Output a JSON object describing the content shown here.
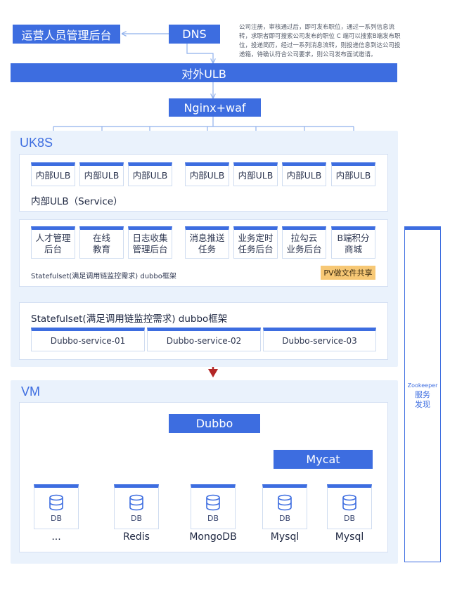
{
  "top": {
    "ops_backend": "运营人员管理后台",
    "dns": "DNS",
    "external_ulb": "对外ULB",
    "nginx": "Nginx+waf",
    "note": "公司注册，审核通过后，即可发布职位，通过一系列信息流转，求职者即可搜索公司发布的职位 C 端可以搜索B端发布职位，投递简历，经过一系列消息流转，则投递信息到达公司投递箱，待确认符合公司要求，则公司发布面试邀请。"
  },
  "uk8s": {
    "title": "UK8S",
    "ulb_cards": [
      "内部ULB",
      "内部ULB",
      "内部ULB",
      "内部ULB",
      "内部ULB",
      "内部ULB",
      "内部ULB"
    ],
    "ulb_panel_label": "内部ULB（Service）",
    "services": [
      [
        "人才管理",
        "后台"
      ],
      [
        "在线",
        "教育"
      ],
      [
        "日志收集",
        "管理后台"
      ],
      [
        "消息推送",
        "任务"
      ],
      [
        "业务定时",
        "任务后台"
      ],
      [
        "拉勾云",
        "业务后台"
      ],
      [
        "B端积分",
        "商城"
      ]
    ],
    "service_panel_label": "Statefulset(满足调用链监控需求) dubbo框架",
    "pv_tag": "PV做文件共享",
    "dubbo_panel_label": "Statefulset(满足调用链监控需求) dubbo框架",
    "dubbo_services": [
      "Dubbo-service-01",
      "Dubbo-service-02",
      "Dubbo-service-03"
    ]
  },
  "vm": {
    "title": "VM",
    "dubbo": "Dubbo",
    "mycat": "Mycat",
    "db_label": "DB",
    "databases": [
      "...",
      "Redis",
      "MongoDB",
      "Mysql",
      "Mysql"
    ]
  },
  "zookeeper": {
    "en": "Zookeeper",
    "cn": "服务发现"
  },
  "colors": {
    "primary": "#3d6de0",
    "region_bg": "#eaf2fc",
    "line": "#8fb0ec",
    "arrow_green": "#26b34a",
    "arrow_red": "#b32626",
    "tag": "#f7c875"
  }
}
